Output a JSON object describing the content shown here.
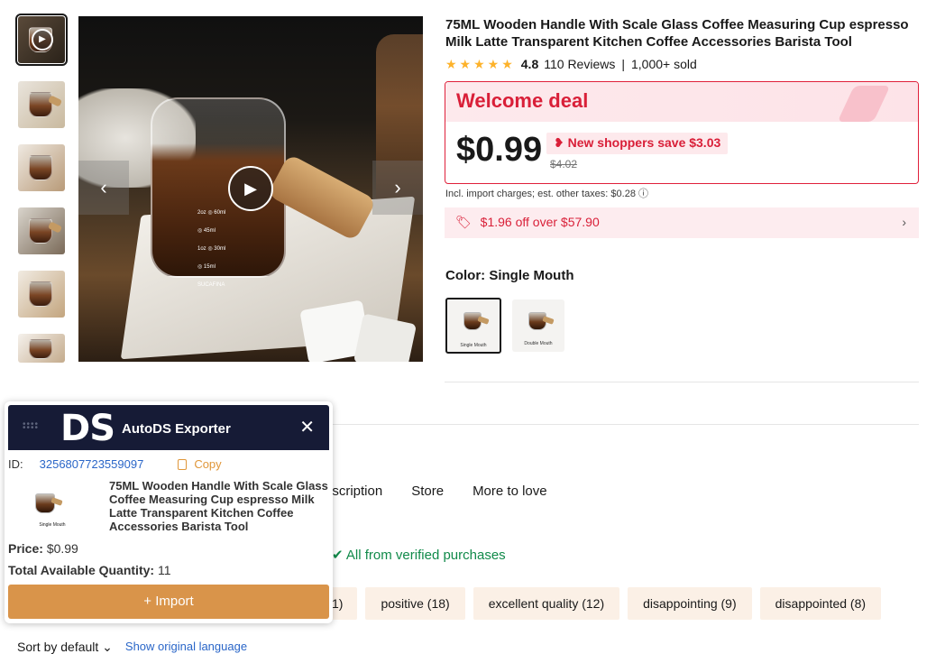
{
  "product": {
    "title": "75ML Wooden Handle With Scale Glass Coffee Measuring Cup espresso Milk Latte Transparent Kitchen Coffee Accessories Barista Tool",
    "stars": "★★★★★",
    "rating": "4.8",
    "reviews": "110 Reviews",
    "separator": "|",
    "sold": "1,000+ sold",
    "deal_label": "Welcome deal",
    "price": "$0.99",
    "save_badge": "New shoppers save $3.03",
    "old_price": "$4.02",
    "taxes": "Incl. import charges; est. other taxes: $0.28 ⓘ",
    "coupon": "$1.96 off over $57.90",
    "color_label": "Color: Single Mouth",
    "swatches": [
      {
        "caption": "Single Mouth",
        "selected": true
      },
      {
        "caption": "Double Mouth",
        "selected": false
      }
    ]
  },
  "gallery": {
    "scale_marks": [
      "2oz ◎ 60ml",
      "◎ 45ml",
      "1oz ◎ 30ml",
      "◎ 15ml",
      "SUCAFINA"
    ]
  },
  "tabs": [
    "escription",
    "Store",
    "More to love"
  ],
  "reviews_section": {
    "verified": "All from verified purchases",
    "chips": [
      "1)",
      "positive (18)",
      "excellent quality (12)",
      "disappointing (9)",
      "disappointed (8)"
    ],
    "sort": "Sort by default",
    "original_language": "Show original language"
  },
  "panel": {
    "logo": "DS",
    "title": "AutoDS Exporter",
    "id_label": "ID:",
    "id_value": "3256807723559097",
    "copy_label": "Copy",
    "thumb_caption": "Single Mouth",
    "product_title": "75ML Wooden Handle With Scale Glass Coffee Measuring Cup espresso Milk Latte Transparent Kitchen Coffee Accessories Barista Tool",
    "price_label": "Price:",
    "price_value": "$0.99",
    "qty_label": "Total Available Quantity:",
    "qty_value": "11",
    "import_label": "+ Import"
  },
  "colors": {
    "accent_red": "#d91f38",
    "verified_green": "#118a4a",
    "import_orange": "#d9944a",
    "panel_header": "#161b36",
    "link_blue": "#2a66c8"
  }
}
